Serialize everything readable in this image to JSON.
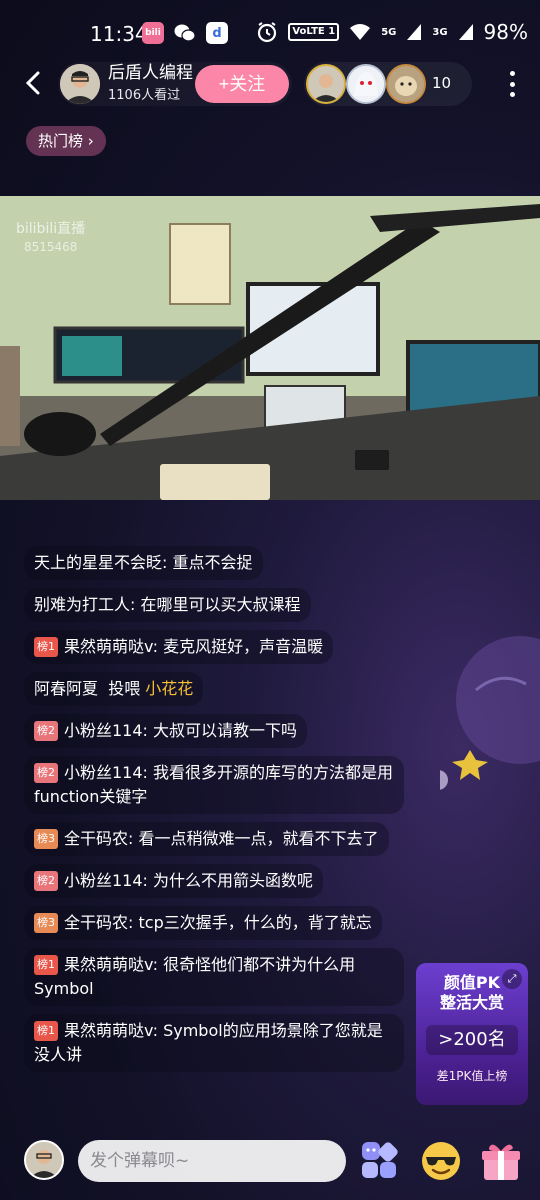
{
  "status_bar": {
    "time": "11:34",
    "volte": "VoLTE 1",
    "signal_5g": "5G",
    "signal_3g": "3G",
    "battery": "98%"
  },
  "header": {
    "host_name": "后盾人编程",
    "viewer_count": "1106人看过",
    "follow_label": "+关注",
    "audience_count": "10"
  },
  "hot_rank_label": "热门榜",
  "video": {
    "watermark": "bilibili直播",
    "room_id": "8515468"
  },
  "chat": {
    "messages": [
      {
        "rank": "",
        "user": "天上的星星不会眨",
        "text": "重点不会捉"
      },
      {
        "rank": "",
        "user": "别难为打工人",
        "text": "在哪里可以买大叔课程"
      },
      {
        "rank": "榜1",
        "user": "果然萌萌哒v",
        "text": "麦克风挺好，声音温暖"
      },
      {
        "rank": "",
        "user": "阿春阿夏",
        "text": "投喂",
        "gift": "小花花"
      },
      {
        "rank": "榜2",
        "user": "小粉丝114",
        "text": "大叔可以请教一下吗"
      },
      {
        "rank": "榜2",
        "user": "小粉丝114",
        "text": "我看很多开源的库写的方法都是用function关键字"
      },
      {
        "rank": "榜3",
        "user": "全干码农",
        "text": "看一点稍微难一点，就看不下去了"
      },
      {
        "rank": "榜2",
        "user": "小粉丝114",
        "text": "为什么不用箭头函数呢"
      },
      {
        "rank": "榜3",
        "user": "全干码农",
        "text": "tcp三次握手，什么的，背了就忘"
      },
      {
        "rank": "榜1",
        "user": "果然萌萌哒v",
        "text": "很奇怪他们都不讲为什么用Symbol"
      },
      {
        "rank": "榜1",
        "user": "果然萌萌哒v",
        "text": "Symbol的应用场景除了您就是没人讲"
      }
    ]
  },
  "pk_card": {
    "title_line1": "颜值PK",
    "title_line2": "整活大赏",
    "rank": ">200名",
    "gap_text": "差1PK值上榜"
  },
  "bottom_bar": {
    "input_placeholder": "发个弹幕呗~"
  },
  "colors": {
    "follow_button": "#fb86a8",
    "gift_name": "#f6c035",
    "rank1_badge": "#e8574a",
    "rank2_badge": "#e8757a",
    "rank3_badge": "#e88a55",
    "pk_card": "#6c3fd0"
  },
  "icons": {
    "back": "chevron-left-icon",
    "more": "more-vertical-icon",
    "hot_rank_arrow": "chevron-right-icon",
    "alarm": "alarm-icon",
    "wifi": "wifi-icon",
    "emoji_tool": "interaction-panel-icon",
    "emoji": "sunglasses-emoji-icon",
    "gift": "gift-box-icon"
  }
}
